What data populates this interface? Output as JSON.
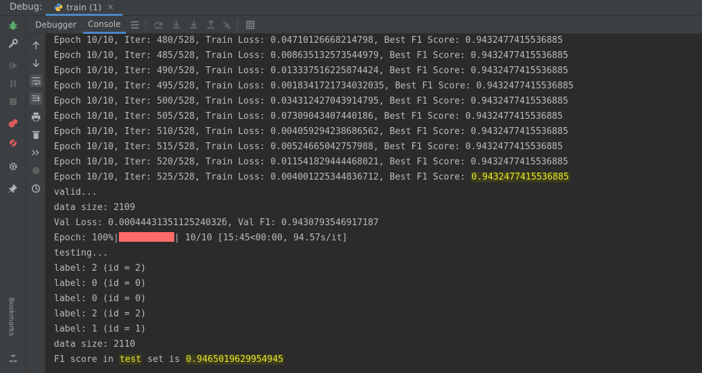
{
  "window": {
    "debug_label": "Debug:",
    "run_tab_label": "train (1)",
    "close_glyph": "×"
  },
  "tabs": [
    {
      "label": "Debugger"
    },
    {
      "label": "Console"
    }
  ],
  "console_lines": [
    "Epoch 10/10, Iter: 480/528, Train Loss: 0.04710126668214798, Best F1 Score: 0.9432477415536885",
    "Epoch 10/10, Iter: 485/528, Train Loss: 0.008635132573544979, Best F1 Score: 0.9432477415536885",
    "Epoch 10/10, Iter: 490/528, Train Loss: 0.013337516225874424, Best F1 Score: 0.9432477415536885",
    "Epoch 10/10, Iter: 495/528, Train Loss: 0.0018341721734032035, Best F1 Score: 0.9432477415536885",
    "Epoch 10/10, Iter: 500/528, Train Loss: 0.034312427043914795, Best F1 Score: 0.9432477415536885",
    "Epoch 10/10, Iter: 505/528, Train Loss: 0.07309043407440186, Best F1 Score: 0.9432477415536885",
    "Epoch 10/10, Iter: 510/528, Train Loss: 0.004059294238686562, Best F1 Score: 0.9432477415536885",
    "Epoch 10/10, Iter: 515/528, Train Loss: 0.00524665042757988, Best F1 Score: 0.9432477415536885",
    "Epoch 10/10, Iter: 520/528, Train Loss: 0.011541829444468021, Best F1 Score: 0.9432477415536885"
  ],
  "line_525": {
    "prefix": "Epoch 10/10, Iter: 525/528, Train Loss: 0.004001225344836712, Best F1 Score: ",
    "highlight": "0.9432477415536885"
  },
  "valid_line": "valid...",
  "data_size_1": "data size: 2109",
  "val_loss_line": "Val Loss: 0.0004443135112524032б, Val F1: 0.9430793546917187",
  "progress": {
    "prefix": "Epoch: 100%|",
    "suffix": "| 10/10 [15:45<00:00, 94.57s/it]",
    "fraction": 1.0
  },
  "testing_line": "testing...",
  "label_lines": [
    "label: 2 (id = 2)",
    "label: 0 (id = 0)",
    "label: 0 (id = 0)",
    "label: 2 (id = 2)",
    "label: 1 (id = 1)"
  ],
  "data_size_2": "data size: 2110",
  "f1_line": {
    "part1": "F1 score in ",
    "hl1": "test",
    "part2": " set is ",
    "hl2": "0.9465019629954945"
  },
  "side_label": "Bookmarks",
  "colors": {
    "highlight_text": "#e8e82c",
    "error_text": "#ff6b68",
    "accent": "#4a88c7"
  }
}
